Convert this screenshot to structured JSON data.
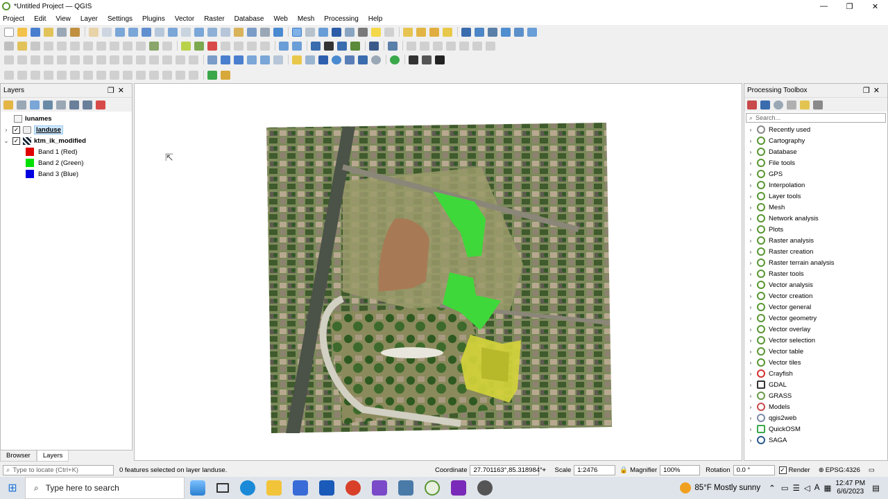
{
  "window": {
    "title": "*Untitled Project — QGIS",
    "controls": [
      "—",
      "❐",
      "✕"
    ]
  },
  "menu": [
    "Project",
    "Edit",
    "View",
    "Layer",
    "Settings",
    "Plugins",
    "Vector",
    "Raster",
    "Database",
    "Web",
    "Mesh",
    "Processing",
    "Help"
  ],
  "layers_panel": {
    "title": "Layers",
    "items": [
      {
        "name": "lunames"
      },
      {
        "name": "landuse"
      },
      {
        "name": "ktm_ik_modified"
      },
      {
        "name": "Band 1 (Red)",
        "color": "#e00000"
      },
      {
        "name": "Band 2 (Green)",
        "color": "#00e000"
      },
      {
        "name": "Band 3 (Blue)",
        "color": "#0000e0"
      }
    ]
  },
  "bottom_tabs": [
    "Browser",
    "Layers"
  ],
  "processing": {
    "title": "Processing Toolbox",
    "search_placeholder": "Search...",
    "items": [
      "Recently used",
      "Cartography",
      "Database",
      "File tools",
      "GPS",
      "Interpolation",
      "Layer tools",
      "Mesh",
      "Network analysis",
      "Plots",
      "Raster analysis",
      "Raster creation",
      "Raster terrain analysis",
      "Raster tools",
      "Vector analysis",
      "Vector creation",
      "Vector general",
      "Vector geometry",
      "Vector overlay",
      "Vector selection",
      "Vector table",
      "Vector tiles",
      "Crayfish",
      "GDAL",
      "GRASS",
      "Models",
      "qgis2web",
      "QuickOSM",
      "SAGA"
    ]
  },
  "status": {
    "locate_placeholder": "Type to locate (Ctrl+K)",
    "message": "0 features selected on layer landuse.",
    "coordinate_label": "Coordinate",
    "coordinate": "27.701163°,85.318984°",
    "scale_label": "Scale",
    "scale": "1:2476",
    "magnifier_label": "Magnifier",
    "magnifier": "100%",
    "rotation_label": "Rotation",
    "rotation": "0.0 °",
    "render_label": "Render",
    "crs": "EPSG:4326"
  },
  "taskbar": {
    "search_placeholder": "Type here to search",
    "weather": "85°F  Mostly sunny",
    "time": "12:47 PM",
    "date": "6/6/2023"
  }
}
